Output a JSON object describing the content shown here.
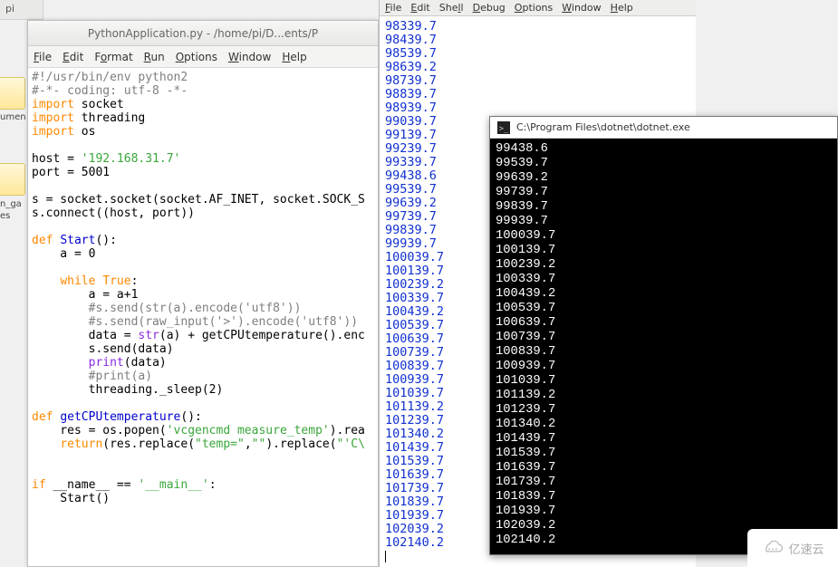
{
  "desktop": {
    "tab_label": "pi",
    "icon_label_1": "umen",
    "icon_label_2": "n_ga",
    "icon_label_3": "es"
  },
  "editor": {
    "title": "PythonApplication.py - /home/pi/D...ents/P",
    "menu": {
      "file": "File",
      "edit": "Edit",
      "format": "Format",
      "run": "Run",
      "options": "Options",
      "window": "Window",
      "help": "Help"
    },
    "code": {
      "l01": "#!/usr/bin/env python2",
      "l02": "#-*- coding: utf-8 -*-",
      "l03_k": "import",
      "l03_t": " socket",
      "l04_k": "import",
      "l04_t": " threading",
      "l05_k": "import",
      "l05_t": " os",
      "blank": "",
      "l07a": "host = ",
      "l07s": "'192.168.31.7'",
      "l08": "port = 5001",
      "l10": "s = socket.socket(socket.AF_INET, socket.SOCK_S",
      "l11": "s.connect((host, port))",
      "l13_k": "def ",
      "l13_n": "Start",
      "l13_t": "():",
      "l14": "    a = 0",
      "l16a": "    ",
      "l16_k": "while ",
      "l16_b": "True",
      "l16_t": ":",
      "l17": "        a = a+1",
      "l18": "        #s.send(str(a).encode('utf8'))",
      "l19": "        #s.send(raw_input('>').encode('utf8'))",
      "l20a": "        data = ",
      "l20_b": "str",
      "l20_t": "(a) + getCPUtemperature().enc",
      "l21": "        s.send(data)",
      "l22a": "        ",
      "l22_b": "print",
      "l22_t": "(data)",
      "l23": "        #print(a)",
      "l24": "        threading._sleep(2)",
      "l26_k": "def ",
      "l26_n": "getCPUtemperature",
      "l26_t": "():",
      "l27a": "    res = os.popen(",
      "l27_s": "'vcgencmd measure_temp'",
      "l27_t": ").rea",
      "l28a": "    ",
      "l28_k": "return",
      "l28_b": "(res.replace(",
      "l28_s1": "\"temp=\"",
      "l28_c": ",",
      "l28_s2": "\"\"",
      "l28_t": ").replace(",
      "l28_s3": "\"'C\\",
      "l31a": "",
      "l31_k": "if ",
      "l31_t": "__name__ == ",
      "l31_s": "'__main__'",
      "l31_e": ":",
      "l32": "    Start()"
    }
  },
  "shell": {
    "menu": {
      "file": "File",
      "edit": "Edit",
      "shell": "Shell",
      "debug": "Debug",
      "options": "Options",
      "window": "Window",
      "help": "Help"
    },
    "lines": [
      "98339.7",
      "98439.7",
      "98539.7",
      "98639.2",
      "98739.7",
      "98839.7",
      "98939.7",
      "99039.7",
      "99139.7",
      "99239.7",
      "99339.7",
      "99438.6",
      "99539.7",
      "99639.2",
      "99739.7",
      "99839.7",
      "99939.7",
      "100039.7",
      "100139.7",
      "100239.2",
      "100339.7",
      "100439.2",
      "100539.7",
      "100639.7",
      "100739.7",
      "100839.7",
      "100939.7",
      "101039.7",
      "101139.2",
      "101239.7",
      "101340.2",
      "101439.7",
      "101539.7",
      "101639.7",
      "101739.7",
      "101839.7",
      "101939.7",
      "102039.2",
      "102140.2"
    ]
  },
  "console": {
    "title": "C:\\Program Files\\dotnet\\dotnet.exe",
    "lines": [
      "99438.6",
      "99539.7",
      "99639.2",
      "99739.7",
      "99839.7",
      "99939.7",
      "100039.7",
      "100139.7",
      "100239.2",
      "100339.7",
      "100439.2",
      "100539.7",
      "100639.7",
      "100739.7",
      "100839.7",
      "100939.7",
      "101039.7",
      "101139.2",
      "101239.7",
      "101340.2",
      "101439.7",
      "101539.7",
      "101639.7",
      "101739.7",
      "101839.7",
      "101939.7",
      "102039.2",
      "102140.2"
    ]
  },
  "watermark": {
    "text": "亿速云"
  }
}
